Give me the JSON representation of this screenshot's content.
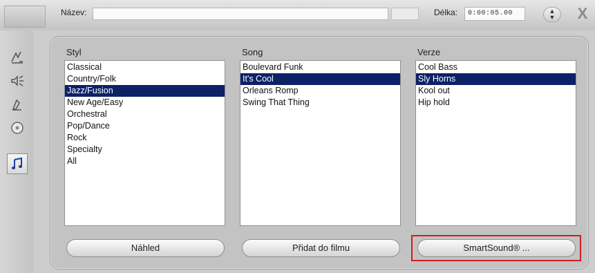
{
  "header": {
    "name_label": "Název:",
    "name_value": "",
    "length_label": "Délka:",
    "length_value": "0:00:05.00",
    "spin_up": "▲",
    "spin_down": "▼",
    "close_glyph": "X"
  },
  "toolbar": {
    "items": [
      {
        "icon": "transition-icon"
      },
      {
        "icon": "sound-effect-icon"
      },
      {
        "icon": "voiceover-icon"
      },
      {
        "icon": "cd-audio-icon"
      },
      {
        "icon": "music-note-icon",
        "active": true
      }
    ]
  },
  "columns": {
    "styl": {
      "label": "Styl",
      "items": [
        "Classical",
        "Country/Folk",
        "Jazz/Fusion",
        "New Age/Easy",
        "Orchestral",
        "Pop/Dance",
        "Rock",
        "Specialty",
        "All"
      ],
      "selected": "Jazz/Fusion"
    },
    "song": {
      "label": "Song",
      "items": [
        "Boulevard Funk",
        "It's Cool",
        "Orleans Romp",
        "Swing That Thing"
      ],
      "selected": "It's Cool"
    },
    "verze": {
      "label": "Verze",
      "items": [
        "Cool Bass",
        "Sly Horns",
        "Kool out",
        "Hip hold"
      ],
      "selected": "Sly Horns"
    }
  },
  "buttons": {
    "preview": "Náhled",
    "add_to_movie": "Přidat do filmu",
    "smartsound": "SmartSound® ..."
  },
  "colors": {
    "selection": "#0d2167",
    "highlight_border": "#cf1d1d",
    "panel": "#c3c3c3"
  }
}
